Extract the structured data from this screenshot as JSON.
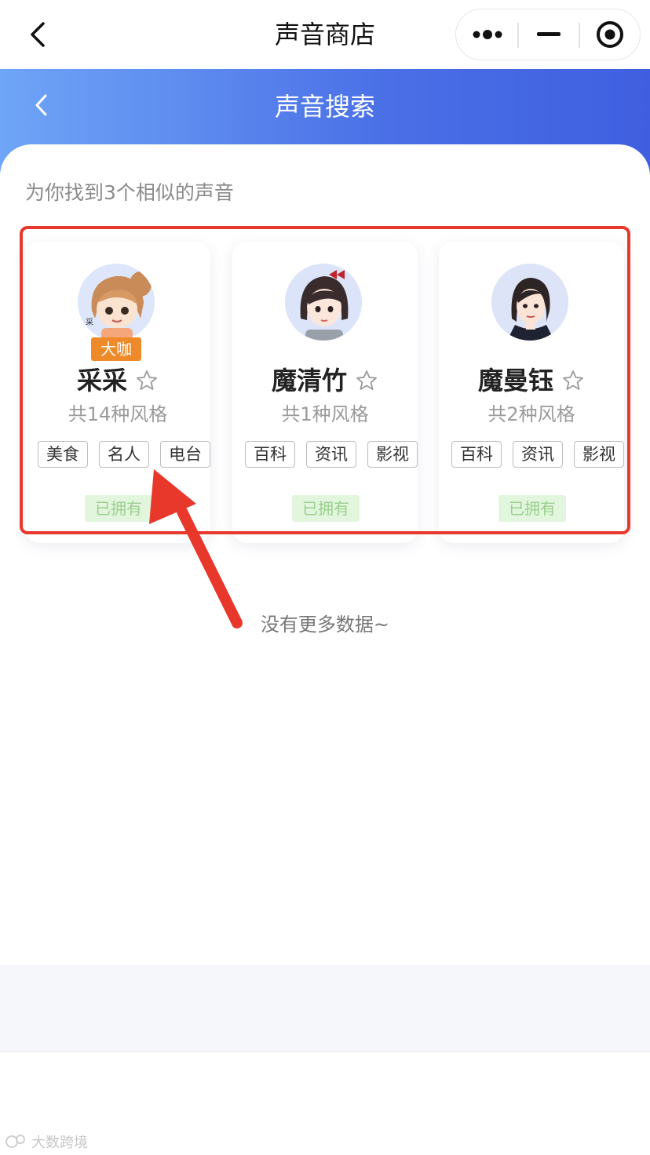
{
  "nav": {
    "title": "声音商店",
    "back_icon": "chevron-left-icon",
    "more_icon": "more-dots-icon",
    "minimize_icon": "minimize-icon",
    "close_icon": "target-close-icon"
  },
  "header": {
    "title": "声音搜索",
    "back_icon": "chevron-left-icon",
    "gradient_from": "#6fa5f7",
    "gradient_to": "#3f5fe0"
  },
  "results": {
    "summary": "为你找到3个相似的声音",
    "voices": [
      {
        "name": "采采",
        "level_badge": "大咖",
        "style_count": "共14种风格",
        "tags": [
          "美食",
          "名人",
          "电台"
        ],
        "status": "已拥有"
      },
      {
        "name": "魔清竹",
        "level_badge": "",
        "style_count": "共1种风格",
        "tags": [
          "百科",
          "资讯",
          "影视"
        ],
        "status": "已拥有"
      },
      {
        "name": "魔曼钰",
        "level_badge": "",
        "style_count": "共2种风格",
        "tags": [
          "百科",
          "资讯",
          "影视"
        ],
        "status": "已拥有"
      }
    ],
    "end_text": "没有更多数据~"
  },
  "colors": {
    "highlight": "#e8382c",
    "badge_orange": "#ef8a2a",
    "owned_green_bg": "#e2f6dd",
    "owned_green_text": "#9bcf8f"
  },
  "watermark": {
    "text": "大数跨境"
  }
}
